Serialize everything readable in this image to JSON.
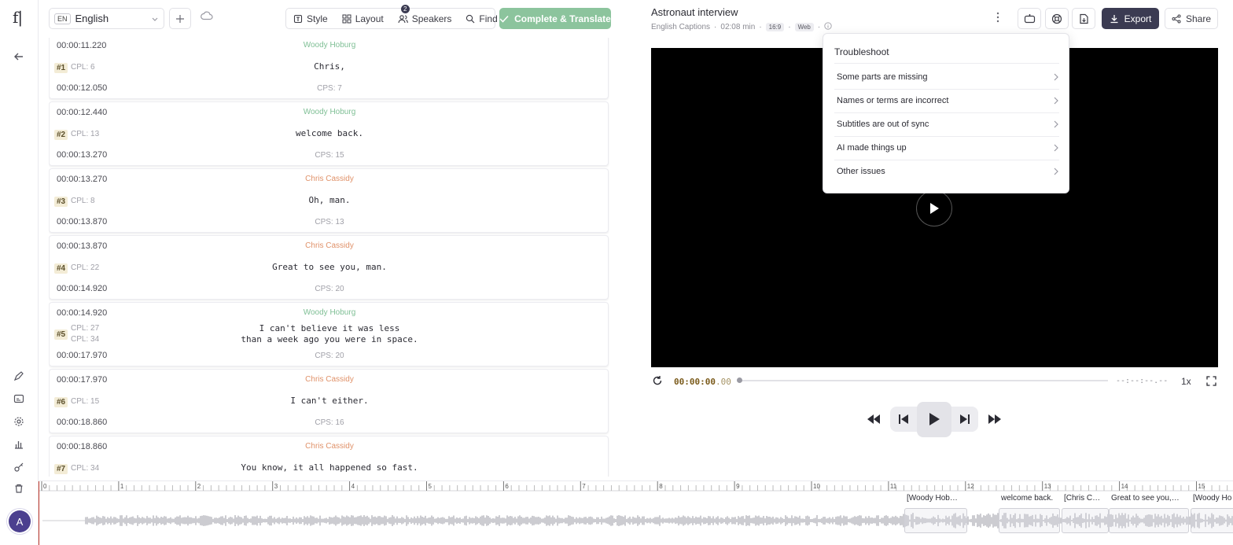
{
  "app": {
    "logo": "f|"
  },
  "toolbar": {
    "language_code": "EN",
    "language": "English",
    "style_label": "Style",
    "layout_label": "Layout",
    "speakers_label": "Speakers",
    "speakers_count": "2",
    "find_label": "Find",
    "complete_label": "Complete & Translate"
  },
  "captions": [
    {
      "index": "#1",
      "start": "00:00:11.220",
      "end": "00:00:12.050",
      "speaker": "Woody Hoburg",
      "speaker_color": "#7fbf95",
      "lines": [
        "Chris,"
      ],
      "cpl": [
        "CPL: 6"
      ],
      "cps": "CPS: 7"
    },
    {
      "index": "#2",
      "start": "00:00:12.440",
      "end": "00:00:13.270",
      "speaker": "Woody Hoburg",
      "speaker_color": "#7fbf95",
      "lines": [
        "welcome back."
      ],
      "cpl": [
        "CPL: 13"
      ],
      "cps": "CPS: 15"
    },
    {
      "index": "#3",
      "start": "00:00:13.270",
      "end": "00:00:13.870",
      "speaker": "Chris Cassidy",
      "speaker_color": "#e0926a",
      "lines": [
        "Oh, man."
      ],
      "cpl": [
        "CPL: 8"
      ],
      "cps": "CPS: 13"
    },
    {
      "index": "#4",
      "start": "00:00:13.870",
      "end": "00:00:14.920",
      "speaker": "Chris Cassidy",
      "speaker_color": "#e0926a",
      "lines": [
        "Great to see you, man."
      ],
      "cpl": [
        "CPL: 22"
      ],
      "cps": "CPS: 20"
    },
    {
      "index": "#5",
      "start": "00:00:14.920",
      "end": "00:00:17.970",
      "speaker": "Woody Hoburg",
      "speaker_color": "#7fbf95",
      "lines": [
        "I can't believe it was less",
        "than a week ago you were in space."
      ],
      "cpl": [
        "CPL: 27",
        "CPL: 34"
      ],
      "cps": "CPS: 20"
    },
    {
      "index": "#6",
      "start": "00:00:17.970",
      "end": "00:00:18.860",
      "speaker": "Chris Cassidy",
      "speaker_color": "#e0926a",
      "lines": [
        "I can't either."
      ],
      "cpl": [
        "CPL: 15"
      ],
      "cps": "CPS: 16"
    },
    {
      "index": "#7",
      "start": "00:00:18.860",
      "end": "",
      "speaker": "Chris Cassidy",
      "speaker_color": "#e0926a",
      "lines": [
        "You know, it all happened so fast."
      ],
      "cpl": [
        "CPL: 34"
      ],
      "cps": ""
    }
  ],
  "player": {
    "title": "Astronaut interview",
    "caption_type": "English Captions",
    "duration": "02:08 min",
    "aspect": "16:9",
    "platform": "Web",
    "export_label": "Export",
    "share_label": "Share",
    "timecode_main": "00:00:00",
    "timecode_frac": ".00",
    "end_time": "--:--:--.--",
    "speed": "1x",
    "progress": 0
  },
  "troubleshoot": {
    "title": "Troubleshoot",
    "items": [
      "Some parts are missing",
      "Names or terms are incorrect",
      "Subtitles are out of sync",
      "AI made things up",
      "Other issues"
    ]
  },
  "timeline": {
    "ticks": [
      "0",
      "1",
      "2",
      "3",
      "4",
      "5",
      "6",
      "7",
      "8",
      "9",
      "10",
      "11",
      "12",
      "13",
      "14",
      "15"
    ],
    "segments": [
      "[Woody Hob…",
      "welcome back.",
      "[Chris C…",
      "Great to see you,…",
      "[Woody Ho"
    ]
  },
  "colors": {
    "accent": "#3b3b52",
    "cta": "#8cc49d",
    "woody": "#7fbf95",
    "chris": "#e0926a"
  }
}
